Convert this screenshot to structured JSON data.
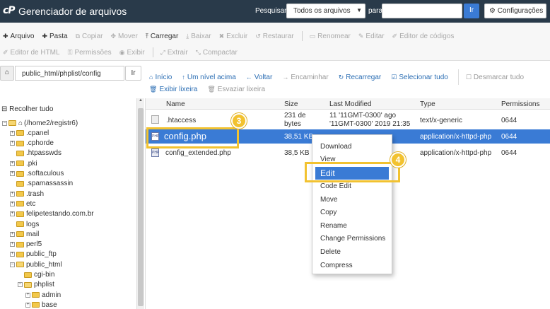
{
  "header": {
    "logo": "cP",
    "title": "Gerenciador de arquivos",
    "search_label": "Pesquisar",
    "search_scope": "Todos os arquivos",
    "for_label": "para",
    "search_value": "",
    "go_label": "Ir",
    "settings_label": "Configurações"
  },
  "toolbar": {
    "row1": [
      {
        "icon": "plus",
        "label": "Arquivo",
        "enabled": true
      },
      {
        "icon": "plus",
        "label": "Pasta",
        "enabled": true
      },
      {
        "icon": "copy",
        "label": "Copiar",
        "enabled": false
      },
      {
        "icon": "move",
        "label": "Mover",
        "enabled": false
      },
      {
        "icon": "upload",
        "label": "Carregar",
        "enabled": true
      },
      {
        "icon": "download",
        "label": "Baixar",
        "enabled": false
      },
      {
        "icon": "close",
        "label": "Excluir",
        "enabled": false
      },
      {
        "icon": "restore",
        "label": "Restaurar",
        "enabled": false
      },
      {
        "icon": "rename",
        "label": "Renomear",
        "enabled": false
      },
      {
        "icon": "pencil",
        "label": "Editar",
        "enabled": false
      },
      {
        "icon": "code",
        "label": "Editor de códigos",
        "enabled": false
      }
    ],
    "row2": [
      {
        "icon": "html",
        "label": "Editor de HTML",
        "enabled": false
      },
      {
        "icon": "key",
        "label": "Permissões",
        "enabled": false
      },
      {
        "icon": "eye",
        "label": "Exibir",
        "enabled": false
      },
      {
        "icon": "extract",
        "label": "Extrair",
        "enabled": false
      },
      {
        "icon": "compress",
        "label": "Compactar",
        "enabled": false
      }
    ]
  },
  "path": {
    "value": "public_html/phplist/config",
    "go_label": "Ir"
  },
  "actions": {
    "row1": [
      {
        "icon": "home",
        "label": "Início",
        "enabled": true
      },
      {
        "icon": "up",
        "label": "Um nível acima",
        "enabled": true
      },
      {
        "icon": "back",
        "label": "Voltar",
        "enabled": true
      },
      {
        "icon": "forward",
        "label": "Encaminhar",
        "enabled": false
      },
      {
        "icon": "reload",
        "label": "Recarregar",
        "enabled": true
      },
      {
        "icon": "check",
        "label": "Selecionar tudo",
        "enabled": true
      },
      {
        "icon": "square",
        "label": "Desmarcar tudo",
        "enabled": false
      }
    ],
    "row2": [
      {
        "icon": "trash",
        "label": "Exibir lixeira",
        "enabled": true
      },
      {
        "icon": "trash",
        "label": "Esvaziar lixeira",
        "enabled": false
      }
    ]
  },
  "tree": {
    "collapse_label": "Recolher tudo",
    "items": [
      {
        "label": "(/home2/registr6)",
        "depth": 0,
        "expander": "minus",
        "open": true,
        "home": true
      },
      {
        "label": ".cpanel",
        "depth": 1,
        "expander": "plus"
      },
      {
        "label": ".cphorde",
        "depth": 1,
        "expander": "plus"
      },
      {
        "label": ".htpasswds",
        "depth": 1,
        "expander": "none"
      },
      {
        "label": ".pki",
        "depth": 1,
        "expander": "plus"
      },
      {
        "label": ".softaculous",
        "depth": 1,
        "expander": "plus"
      },
      {
        "label": ".spamassassin",
        "depth": 1,
        "expander": "none"
      },
      {
        "label": ".trash",
        "depth": 1,
        "expander": "plus"
      },
      {
        "label": "etc",
        "depth": 1,
        "expander": "plus"
      },
      {
        "label": "felipetestando.com.br",
        "depth": 1,
        "expander": "plus"
      },
      {
        "label": "logs",
        "depth": 1,
        "expander": "none"
      },
      {
        "label": "mail",
        "depth": 1,
        "expander": "plus"
      },
      {
        "label": "perl5",
        "depth": 1,
        "expander": "plus"
      },
      {
        "label": "public_ftp",
        "depth": 1,
        "expander": "plus"
      },
      {
        "label": "public_html",
        "depth": 1,
        "expander": "minus",
        "open": true
      },
      {
        "label": "cgi-bin",
        "depth": 2,
        "expander": "none"
      },
      {
        "label": "phplist",
        "depth": 2,
        "expander": "minus",
        "open": true
      },
      {
        "label": "admin",
        "depth": 3,
        "expander": "plus"
      },
      {
        "label": "base",
        "depth": 3,
        "expander": "plus"
      }
    ]
  },
  "table": {
    "headers": {
      "name": "Name",
      "size": "Size",
      "modified": "Last Modified",
      "type": "Type",
      "perms": "Permissions"
    },
    "rows": [
      {
        "icon": "text-file-icon",
        "name": ".htaccess",
        "size1": "231 de",
        "size2": "bytes",
        "mod1": "11 '11GMT-0300' ago",
        "mod2": "'11GMT-0300' 2019 21:35",
        "type": "text/x-generic",
        "perms": "0644",
        "selected": false
      },
      {
        "icon": "php-file-icon",
        "name": "config.php",
        "size1": "38,51 KB",
        "size2": "",
        "mod1": "",
        "mod2": "",
        "type": "application/x-httpd-php",
        "perms": "0644",
        "selected": true
      },
      {
        "icon": "php-file-icon",
        "name": "config_extended.php",
        "size1": "38,5 KB",
        "size2": "",
        "mod1": "",
        "mod2": "",
        "type": "application/x-httpd-php",
        "perms": "0644",
        "selected": false
      }
    ]
  },
  "context_menu": {
    "items": [
      "Download",
      "View",
      "Edit",
      "Code Edit",
      "Move",
      "Copy",
      "Rename",
      "Change Permissions",
      "Delete",
      "Compress"
    ],
    "active_index": 2
  },
  "callouts": [
    {
      "number": "3"
    },
    {
      "number": "4"
    }
  ],
  "colors": {
    "header_bg": "#293a4a",
    "accent": "#3a7bd5",
    "callout": "#f2c230",
    "link": "#2a6db3"
  }
}
